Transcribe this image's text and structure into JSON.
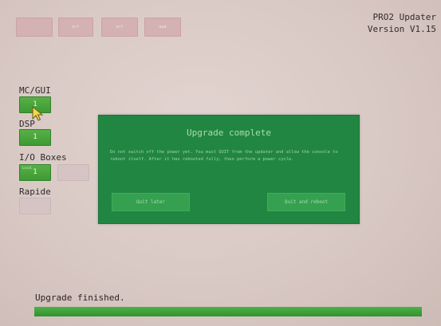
{
  "header": {
    "app_title": "PRO2 Updater",
    "version": "Version V1.15"
  },
  "top_buttons": [
    "",
    "ert",
    "ert",
    "ewd"
  ],
  "sections": {
    "mc_gui": {
      "label": "MC/GUI",
      "slot_value": "1"
    },
    "dsp": {
      "label": "DSP",
      "slot_value": "1"
    },
    "io_boxes": {
      "label": "I/O Boxes",
      "slot_value": "1",
      "slot_tag": "Local"
    },
    "rapide": {
      "label": "Rapide",
      "slot_value": ""
    }
  },
  "dialog": {
    "title": "Upgrade complete",
    "message": "Do not switch off the power yet. You must QUIT from the updater and allow the console to reboot itself. After it has rebooted fully, then perform a power cycle.",
    "quit_later_label": "Quit later",
    "quit_reboot_label": "Quit and reboot"
  },
  "status": {
    "text": "Upgrade finished.",
    "progress": 1.0
  },
  "colors": {
    "dialog_bg": "#228643",
    "progress_green": "#3fa03a",
    "slot_green": "#4ca73d",
    "slot_grey": "#d5c4c3",
    "top_button_pink": "#d4afb1",
    "background": "#dccdc9"
  },
  "icons": {
    "cursor": "mouse-pointer-icon"
  }
}
